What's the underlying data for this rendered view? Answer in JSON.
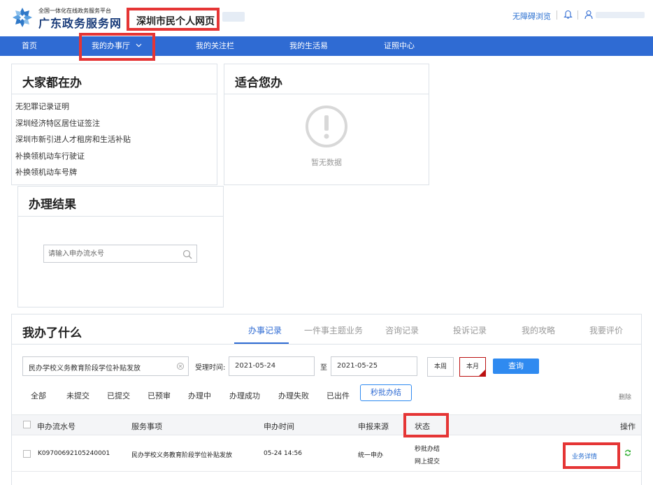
{
  "header": {
    "logo_subtitle": "全国一体化在线政务服务平台",
    "logo_title": "广东政务服务网",
    "site_title": "深圳市民个人网页",
    "accessibility_label": "无障碍浏览"
  },
  "nav": {
    "items": [
      {
        "label": "首页"
      },
      {
        "label": "我的办事厅"
      },
      {
        "label": "我的关注栏"
      },
      {
        "label": "我的生活易"
      },
      {
        "label": "证照中心"
      }
    ]
  },
  "common": {
    "title": "大家都在办",
    "items": [
      "无犯罪记录证明",
      "深圳经济特区居住证签注",
      "深圳市新引进人才租房和生活补贴",
      "补换领机动车行驶证",
      "补换领机动车号牌"
    ]
  },
  "suitable": {
    "title": "适合您办",
    "empty_text": "暂无数据"
  },
  "result": {
    "title": "办理结果",
    "search_placeholder": "请输入申办流水号"
  },
  "records": {
    "title": "我办了什么",
    "tabs": [
      {
        "label": "办事记录"
      },
      {
        "label": "一件事主题业务"
      },
      {
        "label": "咨询记录"
      },
      {
        "label": "投诉记录"
      },
      {
        "label": "我的攻略"
      },
      {
        "label": "我要评价"
      }
    ],
    "filter": {
      "service_value": "民办学校义务教育阶段学位补贴发放",
      "time_label": "受理时间:",
      "start_date": "2021-05-24",
      "to_label": "至",
      "end_date": "2021-05-25",
      "week_label": "本周",
      "month_label": "本月",
      "query_label": "查询"
    },
    "status_tabs": [
      "全部",
      "未提交",
      "已提交",
      "已预审",
      "办理中",
      "办理成功",
      "办理失败",
      "已出件",
      "秒批办结"
    ],
    "delete_label": "删除",
    "columns": [
      "申办流水号",
      "服务事项",
      "申办时间",
      "申报来源",
      "状态",
      "操作"
    ],
    "rows": [
      {
        "serial": "K09700692105240001",
        "service": "民办学校义务教育阶段学位补贴发放",
        "time": "05-24 14:56",
        "source": "统一申办",
        "status_line1": "秒批办结",
        "status_line2": "网上提交",
        "action": "业务详情"
      }
    ]
  },
  "colors": {
    "brand_blue": "#2f6bd3",
    "highlight_red": "#e53535",
    "link_blue": "#2a6fd0",
    "query_button": "#2f8af0"
  }
}
